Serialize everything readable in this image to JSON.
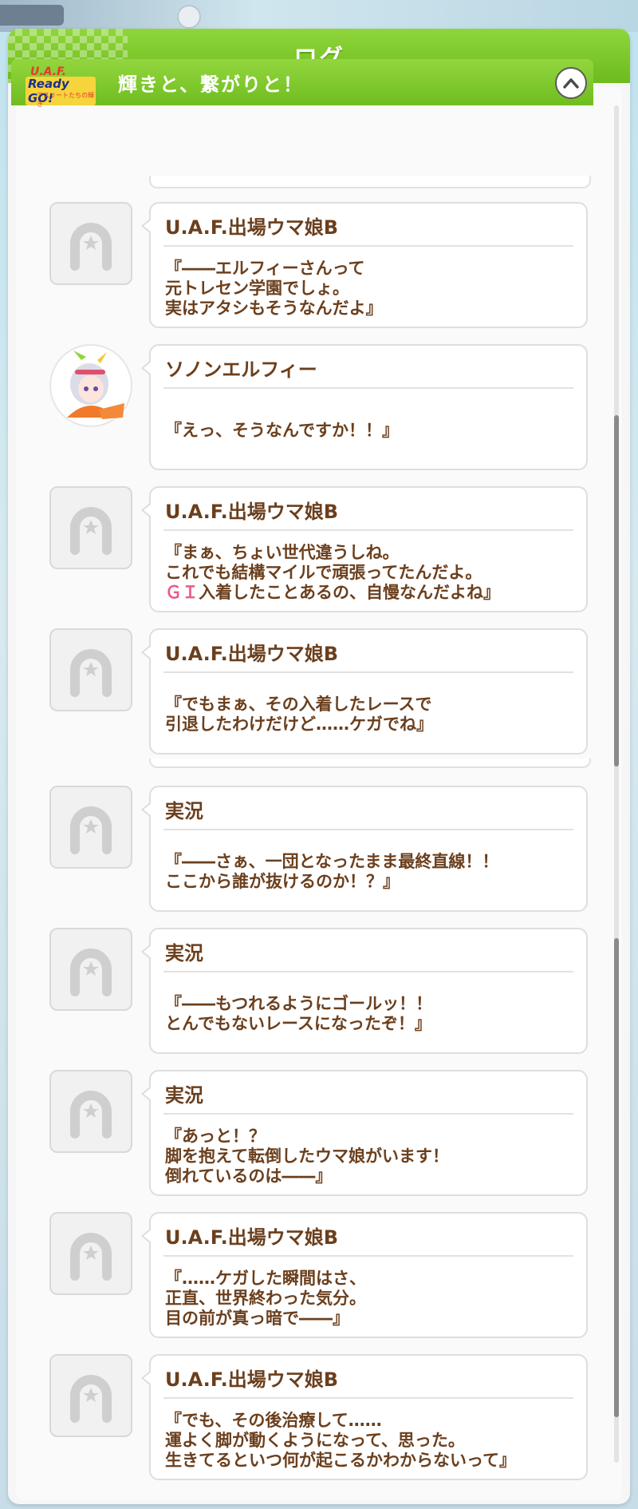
{
  "panel": {
    "title": "ログ"
  },
  "chapter": {
    "title": "輝きと、繋がりと！",
    "logo_line1": "U.A.F.",
    "logo_line2": "Ready GO!",
    "logo_line3": "アスリートたちの輝き"
  },
  "entries": [
    {
      "speaker": "U.A.F.出場ウマ娘B",
      "lines": [
        "『――エルフィーさんって",
        "元トレセン学園でしょ。",
        "実はアタシもそうなんだよ』"
      ]
    },
    {
      "speaker": "ソノンエルフィー",
      "lines": [
        "『えっ、そうなんですか！！』"
      ]
    },
    {
      "speaker": "U.A.F.出場ウマ娘B",
      "lines": [
        "『まぁ、ちょい世代違うしね。",
        "これでも結構マイルで頑張ってたんだよ。"
      ],
      "line3_highlight": "ＧＩ",
      "line3_rest": "入着したことあるの、自慢なんだよね』"
    },
    {
      "speaker": "U.A.F.出場ウマ娘B",
      "lines": [
        "『でもまぁ、その入着したレースで",
        "引退したわけだけど……ケガでね』"
      ]
    },
    {
      "speaker": "実況",
      "lines": [
        "『――さぁ、一団となったまま最終直線！！",
        "ここから誰が抜けるのか！？』"
      ]
    },
    {
      "speaker": "実況",
      "lines": [
        "『――もつれるようにゴールッ！！",
        "とんでもないレースになったぞ！』"
      ]
    },
    {
      "speaker": "実況",
      "lines": [
        "『あっと！？",
        "脚を抱えて転倒したウマ娘がいます！",
        "倒れているのは――』"
      ]
    },
    {
      "speaker": "U.A.F.出場ウマ娘B",
      "lines": [
        "『……ケガした瞬間はさ、",
        "正直、世界終わった気分。",
        "目の前が真っ暗で――』"
      ]
    },
    {
      "speaker": "U.A.F.出場ウマ娘B",
      "lines": [
        "『でも、その後治療して……",
        "運よく脚が動くようになって、思った。",
        "生きてるといつ何が起こるかわからないって』"
      ]
    }
  ],
  "icons": {
    "collapse": "chevron-up-icon",
    "generic_avatar": "horseshoe-icon",
    "character_avatar": "character-portrait"
  },
  "colors": {
    "header_green": "#7cc72a",
    "text_brown": "#6b3f1d",
    "highlight_pink": "#ea5a8a"
  }
}
